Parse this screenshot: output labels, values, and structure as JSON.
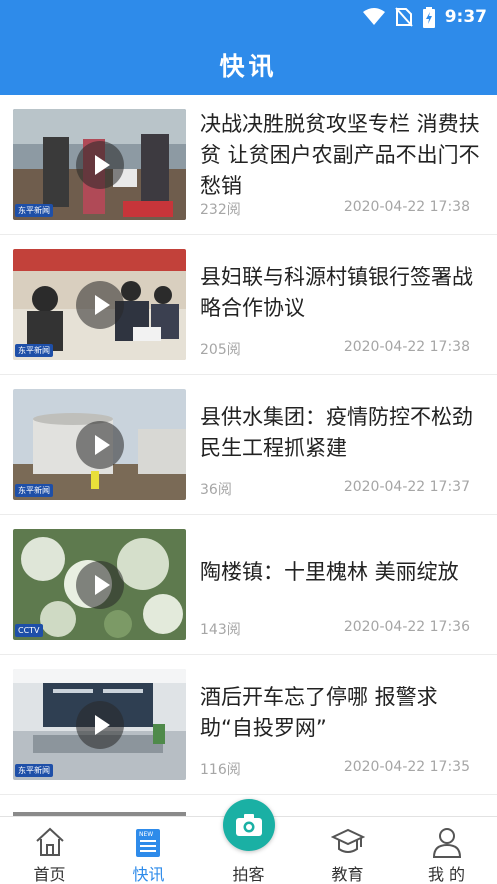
{
  "status_bar": {
    "time": "9:37"
  },
  "header": {
    "title": "快讯"
  },
  "news": [
    {
      "title": "决战决胜脱贫攻坚专栏  消费扶贫 让贫困户农副产品不出门不愁销",
      "views": "232阅",
      "date": "2020-04-22 17:38",
      "badge": "东平新闻"
    },
    {
      "title": "县妇联与科源村镇银行签署战略合作协议",
      "views": "205阅",
      "date": "2020-04-22 17:38",
      "badge": "东平新闻"
    },
    {
      "title": "县供水集团：疫情防控不松劲 民生工程抓紧建",
      "views": "36阅",
      "date": "2020-04-22 17:37",
      "badge": "东平新闻"
    },
    {
      "title": "陶楼镇：十里槐林 美丽绽放",
      "views": "143阅",
      "date": "2020-04-22 17:36",
      "badge": "CCTV"
    },
    {
      "title": "酒后开车忘了停哪 报警求助“自投罗网”",
      "views": "116阅",
      "date": "2020-04-22 17:35",
      "badge": "东平新闻"
    }
  ],
  "tabs": [
    {
      "label": "首页",
      "icon": "home-icon"
    },
    {
      "label": "快讯",
      "icon": "news-icon"
    },
    {
      "label": "拍客",
      "icon": "camera-icon"
    },
    {
      "label": "教育",
      "icon": "graduation-cap-icon"
    },
    {
      "label": "我 的",
      "icon": "user-icon"
    }
  ],
  "colors": {
    "primary": "#2e8bea",
    "camera": "#1ab0a4",
    "meta_text": "#a6a6a6"
  }
}
